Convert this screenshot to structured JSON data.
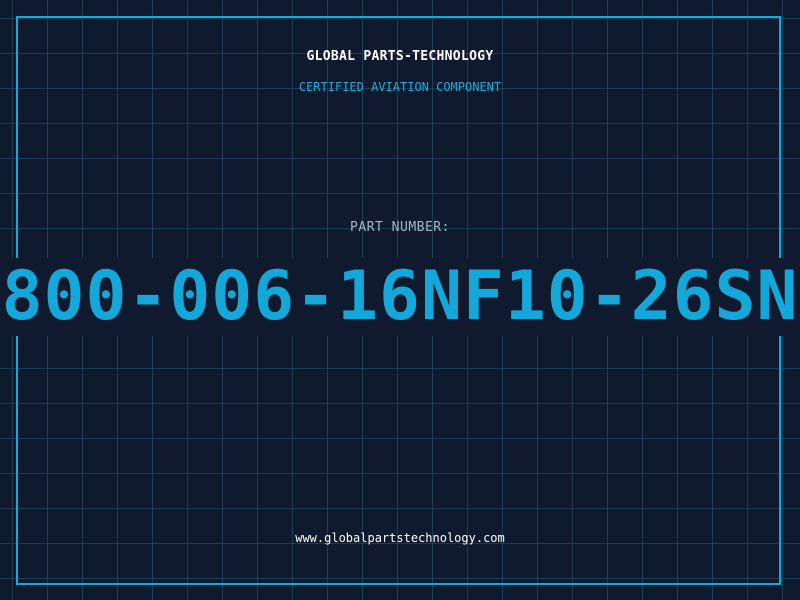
{
  "header": {
    "brand": "GLOBAL PARTS-TECHNOLOGY",
    "tagline": "CERTIFIED AVIATION COMPONENT"
  },
  "part": {
    "label": "PART NUMBER:",
    "number": "800-006-16NF10-26SN"
  },
  "footer": {
    "url": "www.globalpartstechnology.com"
  },
  "colors": {
    "background": "#0f1a2e",
    "grid": "#245c78",
    "accent": "#1ea6d3",
    "part_number": "#13a8d9"
  }
}
